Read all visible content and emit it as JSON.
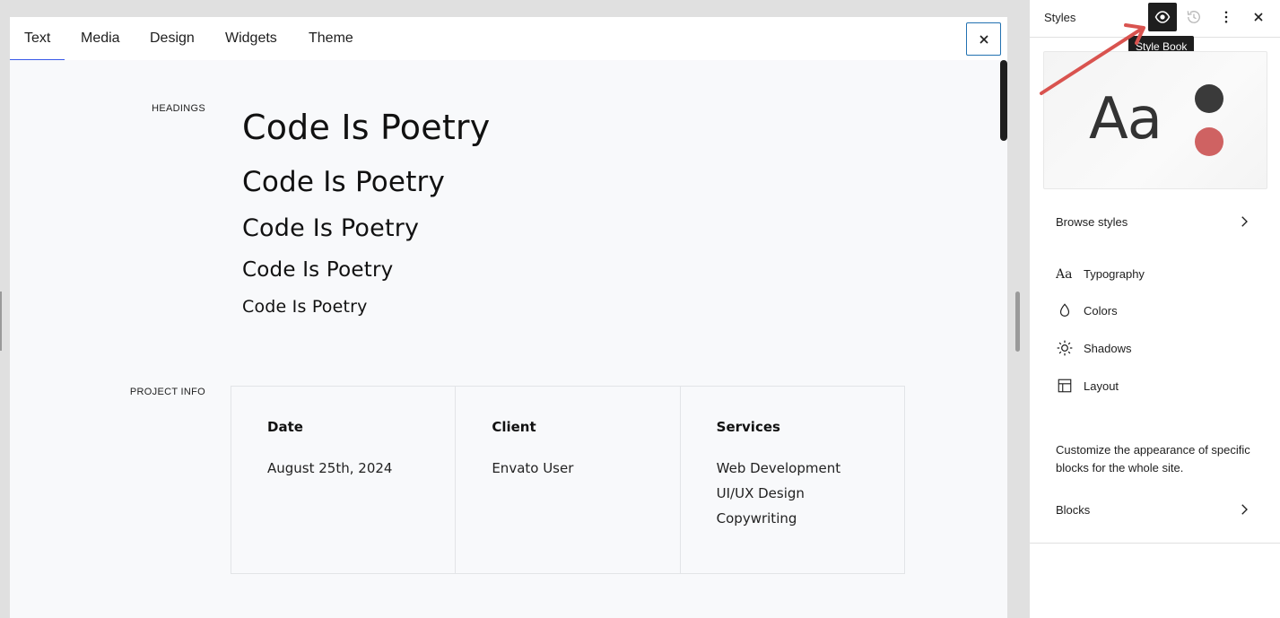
{
  "tabs": [
    "Text",
    "Media",
    "Design",
    "Widgets",
    "Theme"
  ],
  "active_tab": "Text",
  "sections": {
    "headings_label": "HEADINGS",
    "headings": [
      "Code Is Poetry",
      "Code Is Poetry",
      "Code Is Poetry",
      "Code Is Poetry",
      "Code Is Poetry"
    ],
    "project_label": "PROJECT INFO",
    "project": [
      {
        "title": "Date",
        "lines": [
          "August 25th, 2024"
        ]
      },
      {
        "title": "Client",
        "lines": [
          "Envato User"
        ]
      },
      {
        "title": "Services",
        "lines": [
          "Web Development",
          "UI/UX Design",
          "Copywriting"
        ]
      }
    ]
  },
  "sidebar": {
    "title": "Styles",
    "tooltip": "Style Book",
    "preview_text": "Aa",
    "preview_colors": [
      "#3a3a3a",
      "#cf6262"
    ],
    "browse_styles": "Browse styles",
    "items": [
      {
        "label": "Typography",
        "icon": "typography-icon"
      },
      {
        "label": "Colors",
        "icon": "droplet-icon"
      },
      {
        "label": "Shadows",
        "icon": "sun-icon"
      },
      {
        "label": "Layout",
        "icon": "layout-icon"
      }
    ],
    "description": "Customize the appearance of specific blocks for the whole site.",
    "blocks": "Blocks"
  },
  "colors": {
    "accent": "#2271b1",
    "annotation_arrow": "#d9534f"
  }
}
